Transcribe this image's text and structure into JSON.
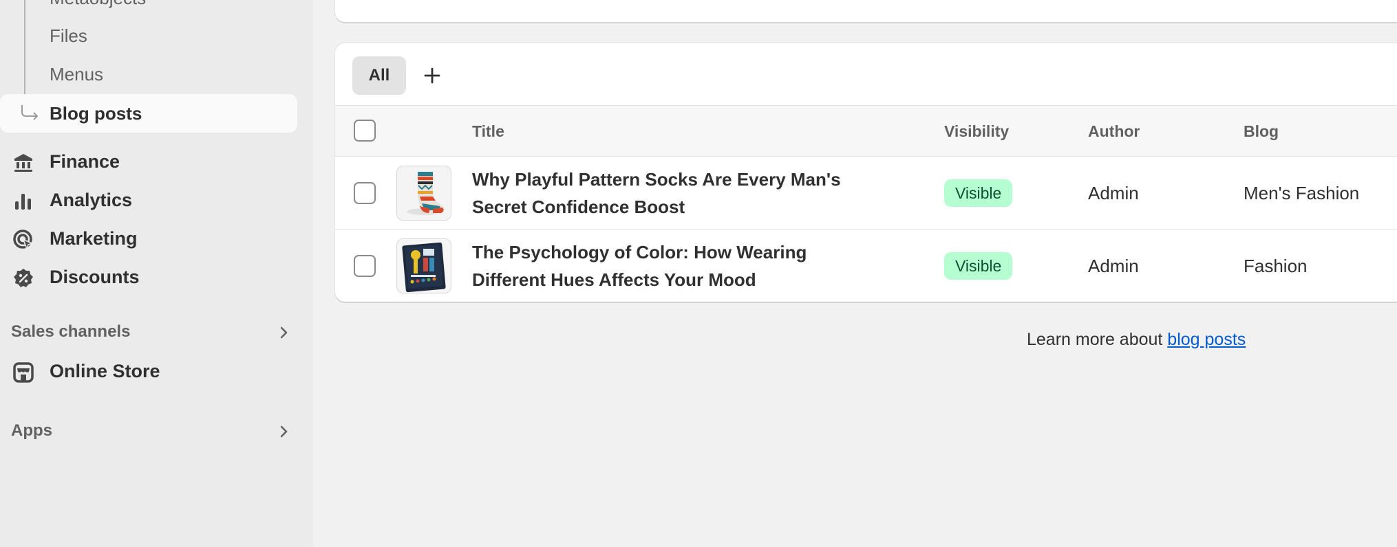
{
  "sidebar": {
    "sub_items": [
      {
        "label": "Metaobjects"
      },
      {
        "label": "Files"
      },
      {
        "label": "Menus"
      }
    ],
    "active_item": {
      "label": "Blog posts"
    },
    "nav_items": [
      {
        "label": "Finance",
        "icon": "bank-icon"
      },
      {
        "label": "Analytics",
        "icon": "bar-chart-icon"
      },
      {
        "label": "Marketing",
        "icon": "target-icon"
      },
      {
        "label": "Discounts",
        "icon": "discount-badge-icon"
      }
    ],
    "sales_channels": {
      "label": "Sales channels",
      "items": [
        {
          "label": "Online Store",
          "icon": "store-icon"
        }
      ]
    },
    "apps": {
      "label": "Apps"
    }
  },
  "main": {
    "tabs": [
      {
        "label": "All"
      }
    ],
    "add_tab_icon": "plus-icon",
    "table": {
      "headers": {
        "title": "Title",
        "visibility": "Visibility",
        "author": "Author",
        "blog": "Blog"
      },
      "rows": [
        {
          "title": "Why Playful Pattern Socks Are Every Man's Secret Confidence Boost",
          "visibility": "Visible",
          "author": "Admin",
          "blog": "Men's Fashion",
          "thumbnail": "patterned-sock-thumbnail"
        },
        {
          "title": "The Psychology of Color: How Wearing Different Hues Affects Your Mood",
          "visibility": "Visible",
          "author": "Admin",
          "blog": "Fashion",
          "thumbnail": "color-book-thumbnail"
        }
      ]
    },
    "footer": {
      "prefix": "Learn more about ",
      "link": "blog posts"
    }
  },
  "colors": {
    "sidebar_bg": "#ebebeb",
    "page_bg": "#f1f1f1",
    "badge_bg": "#b4fed2",
    "badge_text": "#0c5132",
    "link": "#005bd3"
  }
}
